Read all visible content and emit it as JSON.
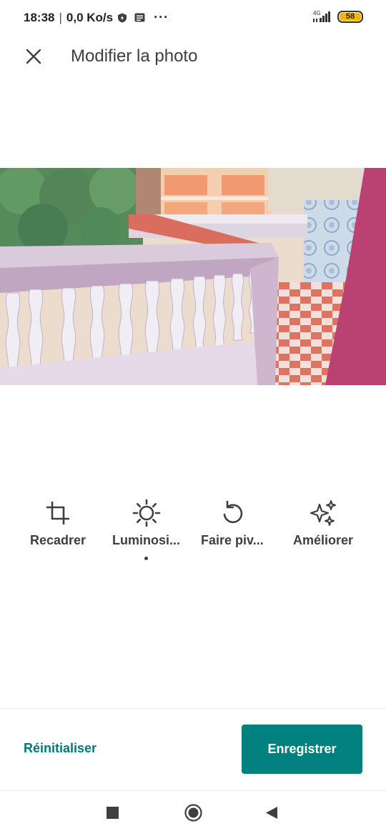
{
  "status_bar": {
    "time": "18:38",
    "separator": "|",
    "net_speed": "0,0 Ko/s",
    "more": "···",
    "network_type": "4G",
    "battery_level": "58",
    "battery_color": "#f5b400"
  },
  "app_bar": {
    "title": "Modifier la photo",
    "close_icon": "close-icon"
  },
  "photo": {
    "description_icon": "photo-preview"
  },
  "tools": [
    {
      "label": "Recadrer",
      "icon": "crop-icon",
      "active": false
    },
    {
      "label": "Luminosi...",
      "icon": "brightness-icon",
      "active": true
    },
    {
      "label": "Faire piv...",
      "icon": "rotate-icon",
      "active": false
    },
    {
      "label": "Améliorer",
      "icon": "sparkles-icon",
      "active": false
    }
  ],
  "actions": {
    "reset_label": "Réinitialiser",
    "save_label": "Enregistrer",
    "accent_color": "#00807f"
  },
  "nav_bar": {
    "recent_icon": "square-icon",
    "home_icon": "home-circle-icon",
    "back_icon": "back-triangle-icon"
  }
}
